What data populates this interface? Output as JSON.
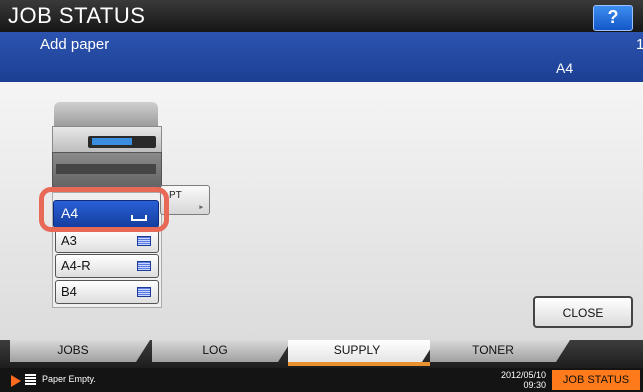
{
  "titlebar": {
    "title": "JOB STATUS",
    "help_label": "?"
  },
  "message": {
    "text": "Add paper",
    "right_marker": "1",
    "paper_size": "A4"
  },
  "printer": {
    "bypass_label": "PT",
    "bypass_arrow": "▸",
    "selected_tray": "A4",
    "trays": [
      {
        "label": "A3"
      },
      {
        "label": "A4-R"
      },
      {
        "label": "B4"
      }
    ]
  },
  "close_label": "CLOSE",
  "tabs": [
    {
      "label": "JOBS"
    },
    {
      "label": "LOG"
    },
    {
      "label": "SUPPLY",
      "active": true
    },
    {
      "label": "TONER"
    }
  ],
  "status": {
    "text": "Paper Empty.",
    "date": "2012/05/10",
    "time": "09:30",
    "jobstatus_label": "JOB STATUS"
  },
  "colors": {
    "accent_blue": "#1c3f93",
    "highlight": "#e86a56",
    "status_orange": "#ff7a1a"
  }
}
